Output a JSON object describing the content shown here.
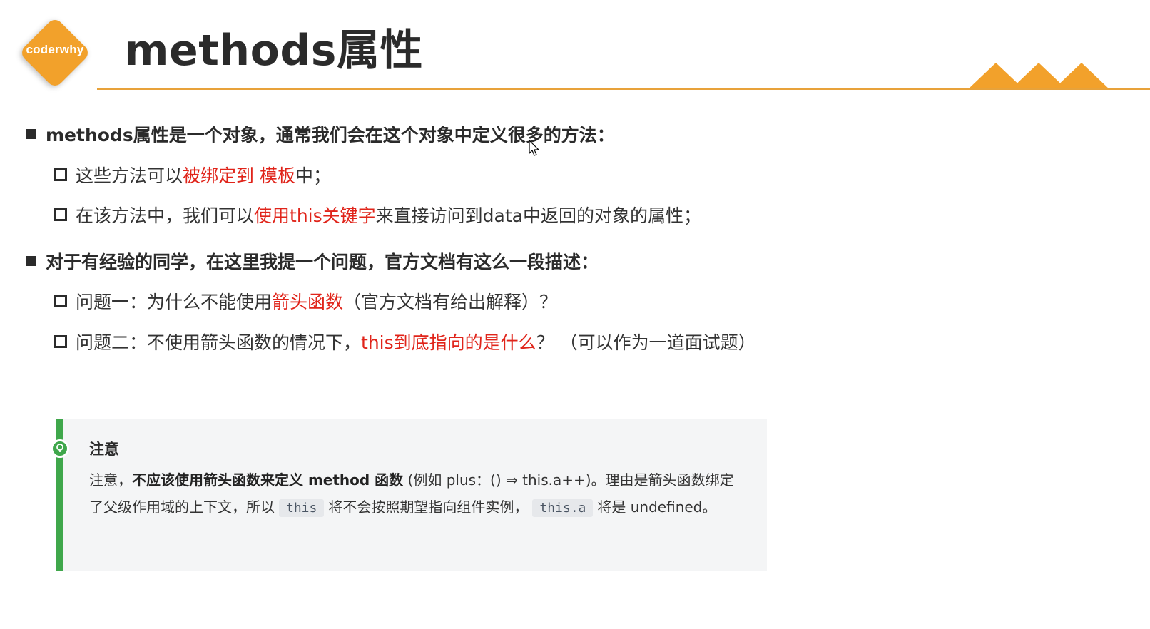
{
  "logo": {
    "text": "coderwhy"
  },
  "title": "methods属性",
  "bullets": [
    {
      "text": "methods属性是一个对象，通常我们会在这个对象中定义很多的方法：",
      "children": [
        {
          "parts": [
            "这些方法可以",
            "被绑定到 模板",
            "中；"
          ]
        },
        {
          "parts": [
            "在该方法中，我们可以",
            "使用this关键字",
            "来直接访问到data中返回的对象的属性；"
          ]
        }
      ]
    },
    {
      "text": "对于有经验的同学，在这里我提一个问题，官方文档有这么一段描述：",
      "children": [
        {
          "parts": [
            "问题一：为什么不能使用",
            "箭头函数",
            "（官方文档有给出解释）？"
          ]
        },
        {
          "parts": [
            "问题二：不使用箭头函数的情况下，",
            "this到底指向的是什么",
            "？ （可以作为一道面试题）"
          ]
        }
      ]
    }
  ],
  "note": {
    "title": "注意",
    "p1": "注意，",
    "bold": "不应该使用箭头函数来定义 method 函数",
    "p2": " (例如 plus：() ⇒ this.a++)。理由是箭头函数绑定了父级作用域的上下文，所以",
    "code1": "this",
    "p3": "将不会按照期望指向组件实例，",
    "code2": "this.a",
    "p4": "将是 undefined。"
  },
  "colors": {
    "accent": "#f2a12b",
    "rule": "#e8a23a",
    "highlight": "#e0241a",
    "note_bar": "#3fa74b",
    "note_bg": "#f4f5f6"
  }
}
